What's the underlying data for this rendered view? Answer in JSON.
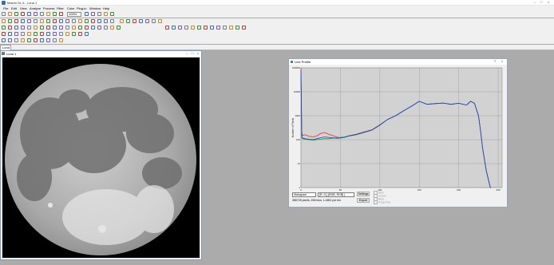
{
  "app": {
    "title": "MaxIm DL 6 - Luna 1"
  },
  "menu": [
    "File",
    "Edit",
    "View",
    "Analyze",
    "Process",
    "Filter",
    "Color",
    "Plug-in",
    "Window",
    "Help"
  ],
  "toolbar": {
    "zoom_value": "100%"
  },
  "tabs": [
    {
      "label": "Luna 1"
    }
  ],
  "image_window": {
    "title": "Luna 1"
  },
  "line_profile": {
    "title": "Line Profile",
    "ylabel": "Number of Pixels",
    "mode_select": "Histogram",
    "channel_select": "[R, G,] [RGB, RGB] (",
    "settings_label": "Settings",
    "export_label": "Export",
    "status_text": "385725 pixels, 256 bins, 1.4651 per bin",
    "checkboxes": [
      "Red",
      "Green",
      "Blue",
      "Gray Plot"
    ],
    "colors": {
      "red": "#e03030",
      "green": "#20a020",
      "blue": "#2040d0",
      "bg": "#d2d2d2"
    }
  },
  "chart_data": {
    "type": "line",
    "title": "",
    "xlabel": "",
    "ylabel": "Number of Pixels",
    "x_ticks": [
      "0",
      "50",
      "100",
      "150",
      "200",
      "250"
    ],
    "y_ticks": [
      "1",
      "10",
      "100",
      "1000",
      "10000",
      "100000"
    ],
    "xlim": [
      0,
      255
    ],
    "ylim_log10": [
      0,
      5
    ],
    "y_scale": "log",
    "grid": true,
    "series": [
      {
        "color": "red",
        "x": [
          0,
          1,
          2,
          5,
          10,
          15,
          20,
          25,
          30,
          35,
          40,
          45,
          50,
          55,
          60,
          70,
          80,
          90,
          100,
          110,
          120,
          130,
          140,
          150,
          160,
          170,
          180,
          190,
          200,
          210,
          215,
          220,
          225,
          228,
          230,
          235,
          240,
          241
        ],
        "y": [
          100000,
          200,
          150,
          160,
          140,
          130,
          145,
          180,
          200,
          170,
          150,
          130,
          120,
          125,
          140,
          160,
          200,
          250,
          400,
          700,
          1000,
          1600,
          2500,
          4000,
          3000,
          3200,
          3400,
          3000,
          3300,
          2800,
          4000,
          3300,
          1000,
          200,
          50,
          5,
          1,
          1
        ]
      },
      {
        "color": "green",
        "x": [
          0,
          1,
          2,
          5,
          10,
          15,
          20,
          25,
          30,
          35,
          40,
          45,
          50,
          55,
          60,
          70,
          80,
          90,
          100,
          110,
          120,
          130,
          140,
          150,
          160,
          170,
          180,
          190,
          200,
          210,
          215,
          220,
          225,
          228,
          230,
          235,
          240,
          241
        ],
        "y": [
          50000,
          120,
          110,
          105,
          100,
          95,
          100,
          105,
          110,
          110,
          115,
          120,
          125,
          130,
          145,
          170,
          210,
          260,
          420,
          700,
          1000,
          1600,
          2500,
          4000,
          3000,
          3200,
          3400,
          3000,
          3300,
          2800,
          4000,
          3300,
          1000,
          200,
          50,
          5,
          1,
          1
        ]
      },
      {
        "color": "blue",
        "x": [
          0,
          1,
          2,
          5,
          10,
          15,
          20,
          25,
          30,
          35,
          40,
          45,
          50,
          55,
          60,
          70,
          80,
          90,
          100,
          110,
          120,
          130,
          140,
          150,
          160,
          170,
          180,
          190,
          200,
          210,
          215,
          220,
          225,
          228,
          230,
          235,
          240,
          241
        ],
        "y": [
          80000,
          130,
          120,
          110,
          105,
          100,
          110,
          120,
          130,
          125,
          120,
          115,
          118,
          125,
          140,
          165,
          205,
          255,
          410,
          700,
          1000,
          1600,
          2500,
          4000,
          3000,
          3200,
          3400,
          3000,
          3300,
          2800,
          4000,
          3300,
          1000,
          200,
          50,
          5,
          1,
          1
        ]
      }
    ]
  }
}
